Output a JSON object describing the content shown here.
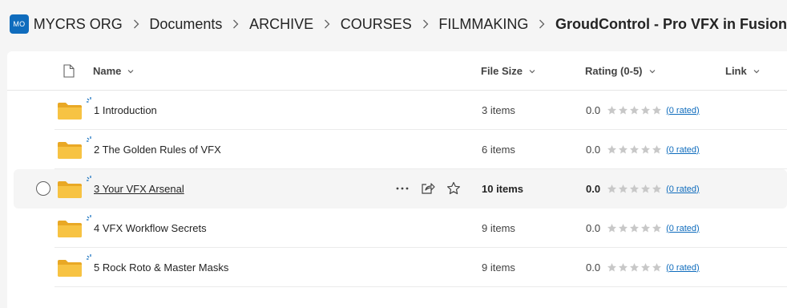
{
  "breadcrumb": {
    "org_badge": "MO",
    "items": [
      "MYCRS ORG",
      "Documents",
      "ARCHIVE",
      "COURSES",
      "FILMMAKING"
    ],
    "current": "GroudControl - Pro VFX in Fusion"
  },
  "columns": {
    "name": "Name",
    "file_size": "File Size",
    "rating": "Rating (0-5)",
    "link": "Link"
  },
  "rows": [
    {
      "name": "1 Introduction",
      "size": "3 items",
      "rating": "0.0",
      "rated": "(0 rated)"
    },
    {
      "name": "2 The Golden Rules of VFX",
      "size": "6 items",
      "rating": "0.0",
      "rated": "(0 rated)"
    },
    {
      "name": "3 Your VFX Arsenal",
      "size": "10 items",
      "rating": "0.0",
      "rated": "(0 rated)"
    },
    {
      "name": "4 VFX Workflow Secrets",
      "size": "9 items",
      "rating": "0.0",
      "rated": "(0 rated)"
    },
    {
      "name": "5 Rock Roto & Master Masks",
      "size": "9 items",
      "rating": "0.0",
      "rated": "(0 rated)"
    }
  ],
  "star_count": 5,
  "colors": {
    "accent": "#0f6cbd",
    "folder": "#f7c343",
    "star": "#c8c8c8"
  },
  "icons": {
    "header": "document-icon",
    "folder": "folder-icon",
    "new_badge": "sparkle-icon",
    "row_actions": [
      "more-icon",
      "share-icon",
      "star-outline-icon"
    ]
  }
}
